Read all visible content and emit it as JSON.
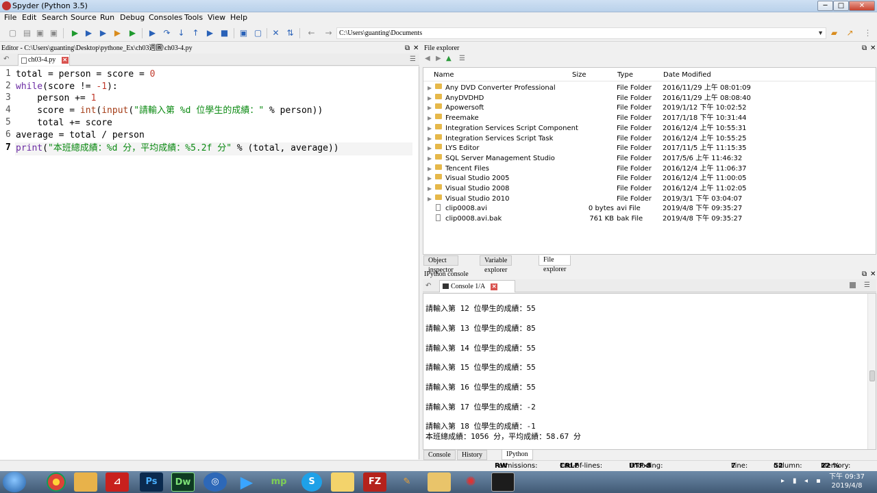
{
  "window": {
    "title": "Spyder (Python 3.5)",
    "min": "─",
    "max": "□",
    "close": "✕"
  },
  "menu": [
    "File",
    "Edit",
    "Search",
    "Source",
    "Run",
    "Debug",
    "Consoles",
    "Tools",
    "View",
    "Help"
  ],
  "toolbar": {
    "path": "C:\\Users\\guanting\\Documents",
    "back": "←",
    "forward": "→"
  },
  "editor": {
    "title": "Editor - C:\\Users\\guanting\\Desktop\\pythone_Ex\\ch03週圖\\ch03-4.py",
    "tab": "ch03-4.py",
    "lines": [
      "1",
      "2",
      "3",
      "4",
      "5",
      "6",
      "7"
    ]
  },
  "file_explorer": {
    "title": "File explorer",
    "columns": {
      "name": "Name",
      "size": "Size",
      "type": "Type",
      "date": "Date Modified"
    },
    "rows": [
      {
        "name": "Any DVD Converter Professional",
        "size": "",
        "type": "File Folder",
        "date": "2016/11/29 上午 08:01:09",
        "kind": "folder"
      },
      {
        "name": "AnyDVDHD",
        "size": "",
        "type": "File Folder",
        "date": "2016/11/29 上午 08:08:40",
        "kind": "folder"
      },
      {
        "name": "Apowersoft",
        "size": "",
        "type": "File Folder",
        "date": "2019/1/12 下午 10:02:52",
        "kind": "folder"
      },
      {
        "name": "Freemake",
        "size": "",
        "type": "File Folder",
        "date": "2017/1/18 下午 10:31:44",
        "kind": "folder"
      },
      {
        "name": "Integration Services Script Component",
        "size": "",
        "type": "File Folder",
        "date": "2016/12/4 上午 10:55:31",
        "kind": "folder"
      },
      {
        "name": "Integration Services Script Task",
        "size": "",
        "type": "File Folder",
        "date": "2016/12/4 上午 10:55:25",
        "kind": "folder"
      },
      {
        "name": "LYS Editor",
        "size": "",
        "type": "File Folder",
        "date": "2017/11/5 上午 11:15:35",
        "kind": "folder"
      },
      {
        "name": "SQL Server Management Studio",
        "size": "",
        "type": "File Folder",
        "date": "2017/5/6 上午 11:46:32",
        "kind": "folder"
      },
      {
        "name": "Tencent Files",
        "size": "",
        "type": "File Folder",
        "date": "2016/12/4 上午 11:06:37",
        "kind": "folder"
      },
      {
        "name": "Visual Studio 2005",
        "size": "",
        "type": "File Folder",
        "date": "2016/12/4 上午 11:00:05",
        "kind": "folder"
      },
      {
        "name": "Visual Studio 2008",
        "size": "",
        "type": "File Folder",
        "date": "2016/12/4 上午 11:02:05",
        "kind": "folder"
      },
      {
        "name": "Visual Studio 2010",
        "size": "",
        "type": "File Folder",
        "date": "2019/3/1 下午 03:04:07",
        "kind": "folder"
      },
      {
        "name": "clip0008.avi",
        "size": "0 bytes",
        "type": "avi File",
        "date": "2019/4/8 下午 09:35:27",
        "kind": "file"
      },
      {
        "name": "clip0008.avi.bak",
        "size": "761 KB",
        "type": "bak File",
        "date": "2019/4/8 下午 09:35:27",
        "kind": "file"
      }
    ]
  },
  "upper_tabs": [
    "Object inspector",
    "Variable explorer",
    "File explorer"
  ],
  "ipython": {
    "title": "IPython console",
    "tab": "Console 1/A",
    "output": [
      "請輸入第 12 位學生的成績：55",
      "請輸入第 13 位學生的成績：85",
      "請輸入第 14 位學生的成績：55",
      "請輸入第 15 位學生的成績：55",
      "請輸入第 16 位學生的成績：55",
      "請輸入第 17 位學生的成績：-2",
      "請輸入第 18 位學生的成績：-1",
      "本班總成績：1056 分，平均成績：58.67 分"
    ]
  },
  "lower_tabs": [
    "Console",
    "History log",
    "IPython console"
  ],
  "status": {
    "permissions_label": "Permissions:",
    "permissions": "RW",
    "eol_label": "End-of-lines:",
    "eol": "CRLF",
    "encoding_label": "Encoding:",
    "encoding": "UTF-8",
    "line_label": "Line:",
    "line": "7",
    "column_label": "Column:",
    "column": "52",
    "memory_label": "Memory:",
    "memory": "22 %"
  },
  "taskbar": {
    "time": "下午 09:37",
    "date": "2019/4/8",
    "apps": [
      "chrome",
      "paint",
      "acrobat",
      "Ps",
      "Dw",
      "network",
      "media",
      "mp",
      "S",
      "folder",
      "FZ",
      "brush",
      "explorer",
      "gear",
      "app"
    ]
  },
  "colors": {
    "keyword": "#6a2aa3",
    "string": "#0b8a12",
    "number": "#c0392b",
    "accent": "#2a62b8"
  }
}
